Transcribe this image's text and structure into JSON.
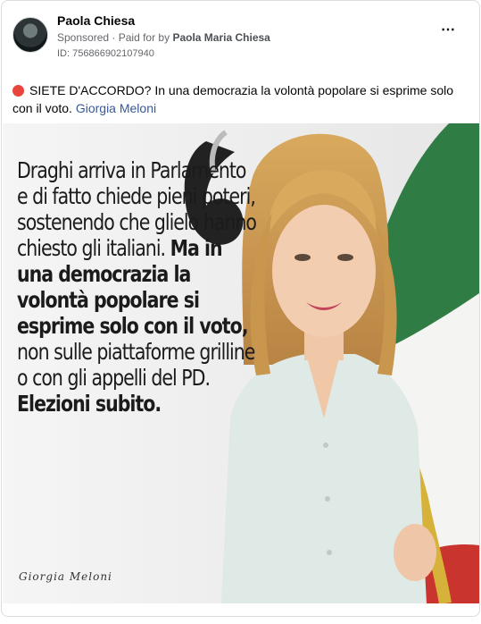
{
  "post": {
    "author": "Paola Chiesa",
    "sponsored": "Sponsored",
    "paid_for_prefix": "Paid for by",
    "payer": "Paola Maria Chiesa",
    "ad_id": "ID: 756866902107940",
    "more_icon": "⋯",
    "caption_text": "SIETE D'ACCORDO? In una democrazia la volontà popolare si esprime solo con il voto.",
    "caption_link": "Giorgia Meloni"
  },
  "image": {
    "quote_part1": "Draghi arriva in Parlamento e di fatto chiede pieni poteri, sostenendo che glielo hanno chiesto gli italiani. ",
    "quote_bold1": "Ma in una democrazia la volontà popolare si esprime solo con il voto,",
    "quote_part2": " non sulle piattaforme grilline o con gli appelli del PD. ",
    "quote_bold2": "Elezioni subito.",
    "signature": "Giorgia Meloni"
  },
  "colors": {
    "flag_green": "#2f7d45",
    "flag_white": "#f4f4f2",
    "flag_red": "#c9342e",
    "fringe_gold": "#d6b23a",
    "link": "#385898"
  }
}
